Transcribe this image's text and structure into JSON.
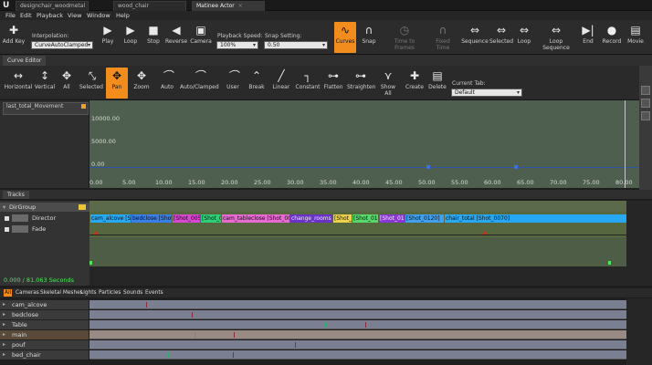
{
  "tabs": [
    {
      "label": "designchair_woodmetal",
      "active": false
    },
    {
      "label": "wood_chair",
      "active": false
    },
    {
      "label": "Matinee Actor",
      "active": true
    }
  ],
  "menu": [
    "File",
    "Edit",
    "Playback",
    "View",
    "Window",
    "Help"
  ],
  "toolbar": {
    "add_key": "Add Key",
    "interpolation_label": "Interpolation:",
    "interpolation_value": "CurveAutoClamped",
    "play": "Play",
    "loop": "Loop",
    "stop": "Stop",
    "reverse": "Reverse",
    "camera": "Camera",
    "playback_speed_label": "Playback Speed:",
    "playback_speed_value": "100%",
    "snap_label": "Snap Setting:",
    "snap_value": "0.50",
    "curves": "Curves",
    "snap": "Snap",
    "time_to_frames": "Time to Frames",
    "fixed_time": "Fixed Time",
    "sequence": "Sequence",
    "selected": "Selected",
    "loop2": "Loop",
    "loop_sequence": "Loop Sequence",
    "end": "End",
    "record": "Record",
    "movie": "Movie"
  },
  "curve_editor": {
    "tab": "Curve Editor",
    "buttons": [
      "Horizontal",
      "Vertical",
      "All",
      "Selected",
      "Pan",
      "Zoom",
      "Auto",
      "Auto/Clamped",
      "User",
      "Break",
      "Linear",
      "Constant",
      "Flatten",
      "Straighten",
      "Show All",
      "Create",
      "Delete"
    ],
    "current_tab_label": "Current Tab:",
    "current_tab_value": "Default",
    "curve_item": "last_total_Movement",
    "y_labels": [
      "10000.00",
      "5000.00",
      "0.00"
    ],
    "x_labels": [
      "0.00",
      "5.00",
      "10.00",
      "15.00",
      "20.00",
      "25.00",
      "30.00",
      "35.00",
      "40.00",
      "45.00",
      "50.00",
      "55.00",
      "60.00",
      "65.00",
      "70.00",
      "75.00",
      "80.00"
    ]
  },
  "tracks": {
    "tab": "Tracks",
    "rows": [
      "DirGroup",
      "Director",
      "Fade"
    ],
    "segments": [
      {
        "label": "cam_alcove [Shot_0030]",
        "color": "#27a8f2"
      },
      {
        "label": "bedclose [Shot_0040]",
        "color": "#3a7ee8"
      },
      {
        "label": "[Shot_0050]",
        "color": "#d946d1"
      },
      {
        "label": "[Shot_0060]",
        "color": "#2fcf7a"
      },
      {
        "label": "cam_tableclose [Shot_0080]",
        "color": "#e86ad2"
      },
      {
        "label": "change_rooms",
        "color": "#6b32c9"
      },
      {
        "label": "[Shot_0090]",
        "color": "#f0d24a"
      },
      {
        "label": "[Shot_0100]",
        "color": "#56d86a"
      },
      {
        "label": "[Shot_0110]",
        "color": "#8b37d6"
      },
      {
        "label": "[Shot_0120]",
        "color": "#3fa0f0"
      },
      {
        "label": "chair_total [Shot_0070]",
        "color": "#27a8f2"
      }
    ],
    "time": "0.000 / 81.063 Seconds"
  },
  "filters": [
    "All",
    "Cameras",
    "Skeletal Meshes",
    "Lights",
    "Particles",
    "Sounds",
    "Events"
  ],
  "groups": [
    "cam_alcove",
    "bedclose",
    "Table",
    "main",
    "pouf",
    "bed_chair"
  ]
}
